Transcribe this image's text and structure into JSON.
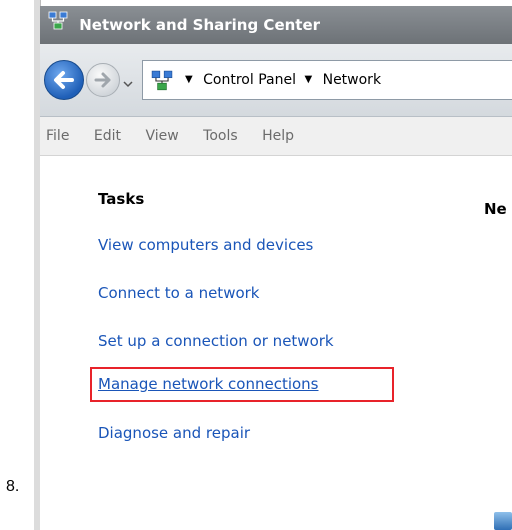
{
  "step_number": "8.",
  "window": {
    "title": "Network and Sharing Center"
  },
  "nav": {
    "back_icon": "back-arrow-icon",
    "forward_icon": "forward-arrow-icon",
    "address_crumbs": [
      "Control Panel",
      "Network"
    ]
  },
  "menu": {
    "items": [
      "File",
      "Edit",
      "View",
      "Tools",
      "Help"
    ]
  },
  "tasks": {
    "heading": "Tasks",
    "links": [
      "View computers and devices",
      "Connect to a network",
      "Set up a connection or network",
      "Manage network connections",
      "Diagnose and repair"
    ],
    "highlighted_index": 3
  },
  "main": {
    "heading_partial": "Ne"
  },
  "colors": {
    "link": "#1a55b8",
    "highlight": "#e8232a",
    "title_bar": "#7a7f84"
  }
}
